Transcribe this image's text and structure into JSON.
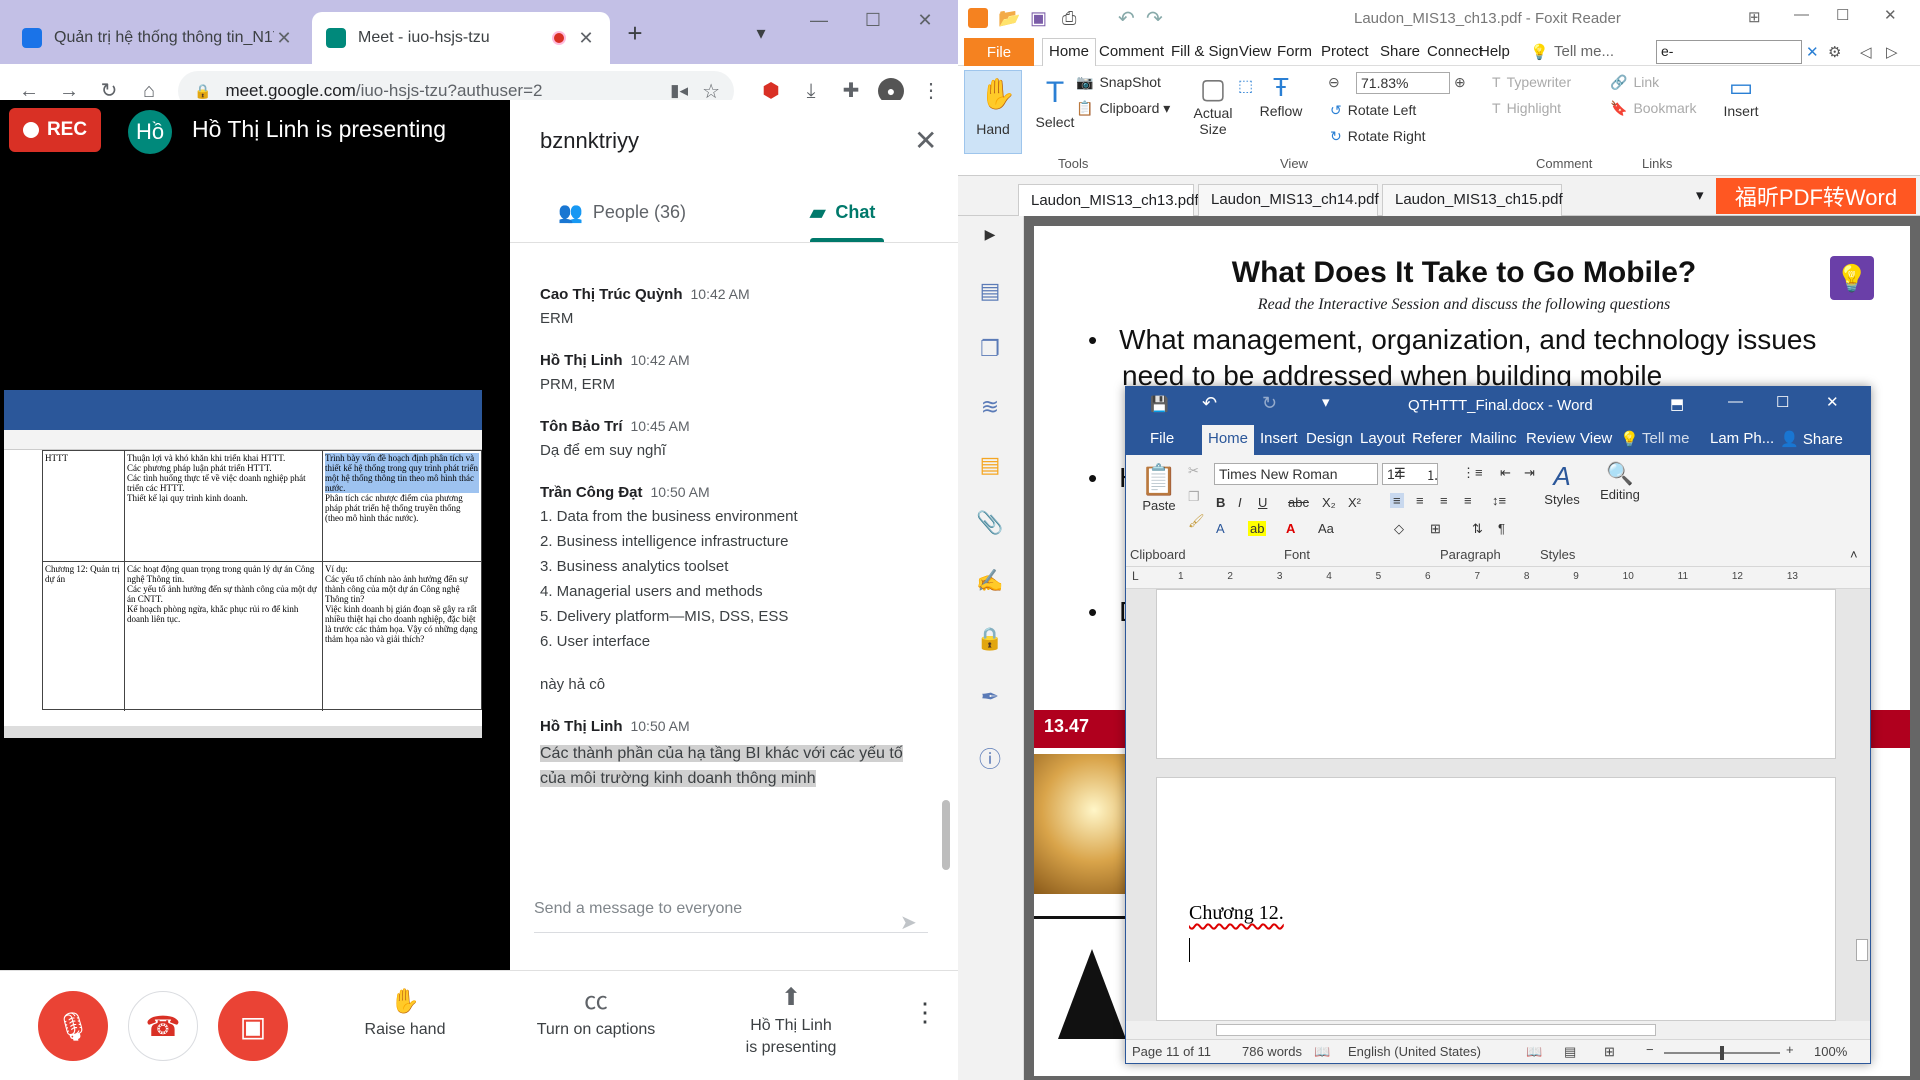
{
  "chrome": {
    "tabs": [
      {
        "title": "Quản trị hệ thống thông tin_N1T",
        "favicon_color": "#1a73e8"
      },
      {
        "title": "Meet - iuo-hsjs-tzu",
        "favicon_color": "#00897b",
        "recording": true
      }
    ],
    "url_host": "meet.google.com",
    "url_path": "/iuo-hsjs-tzu?authuser=2",
    "new_tab_label": "+"
  },
  "meet": {
    "rec_label": "REC",
    "presenter_initials": "Hồ",
    "presenting_title": "Hồ Thị Linh is presenting",
    "meeting_code": "bznnktriyy",
    "people_tab": "People (36)",
    "chat_tab": "Chat",
    "messages": [
      {
        "author": "Cao Thị Trúc Quỳnh",
        "time": "10:42 AM",
        "lines": [
          "ERM"
        ]
      },
      {
        "author": "Hồ Thị Linh",
        "time": "10:42 AM",
        "lines": [
          "PRM, ERM"
        ]
      },
      {
        "author": "Tôn Bảo Trí",
        "time": "10:45 AM",
        "lines": [
          "Dạ để em suy nghĩ"
        ]
      },
      {
        "author": "Trần Công Đạt",
        "time": "10:50 AM",
        "lines": [
          "1. Data from the business environment",
          "2. Business intelligence infrastructure",
          "3. Business analytics toolset",
          "4. Managerial users and methods",
          "5. Delivery platform—MIS, DSS, ESS",
          "6. User interface",
          "",
          "này hả cô"
        ]
      },
      {
        "author": "Hồ Thị Linh",
        "time": "10:50 AM",
        "lines": [
          "Các thành phần của hạ tầng BI khác với các yếu tố của môi trường kinh doanh thông minh"
        ],
        "selected": true
      }
    ],
    "send_placeholder": "Send a message to everyone",
    "controls": {
      "raise_hand": "Raise hand",
      "captions": "Turn on captions",
      "presenting_line1": "Hồ Thị Linh",
      "presenting_line2": "is presenting"
    },
    "shared_doc": {
      "row1_col1": "HTTT",
      "row1_col2": [
        "Thuận lợi và khó khăn khi triển khai HTTT.",
        "Các phương pháp luận phát triển HTTT.",
        "Các tình huống thực tế về việc doanh nghiệp phát triển các HTTT.",
        "Thiết kế lại quy trình kinh doanh."
      ],
      "row1_col3": [
        "Trình bày vấn đề hoạch định phân tích và thiết kế hệ thống trong quy trình phát triển một hệ thống thông tin theo mô hình thác nước.",
        "Phân tích các nhược điểm của phương pháp phát triển hệ thống truyền thống (theo mô hình thác nước)."
      ],
      "row2_col1": "Chương 12: Quản trị dự án",
      "row2_col2": [
        "Các hoạt động quan trọng trong quản lý dự án Công nghệ Thông tin.",
        "Các yếu tố ảnh hưởng đến sự thành công của một dự án CNTT.",
        "Kế hoạch phòng ngừa, khắc phục rủi ro để kinh doanh liên tục."
      ],
      "row2_col3": [
        "Ví dụ:",
        "Các yếu tố chính nào ảnh hưởng đến sự thành công của một dự án Công nghệ Thông tin?",
        "Việc kinh doanh bị gián đoạn sẽ gây ra rất nhiều thiệt hại cho doanh nghiệp, đặc biệt là trước các thảm họa. Vậy có những dạng thảm họa nào và giải thích?"
      ]
    }
  },
  "foxit": {
    "title": "Laudon_MIS13_ch13.pdf - Foxit Reader",
    "menu": [
      "Home",
      "Comment",
      "Fill & Sign",
      "View",
      "Form",
      "Protect",
      "Share",
      "Connect",
      "Help"
    ],
    "file_label": "File",
    "tell_me": "Tell me...",
    "search_value": "e-",
    "ribbon": {
      "hand": "Hand",
      "select": "Select",
      "snapshot": "SnapShot",
      "clipboard": "Clipboard",
      "actual_size": "Actual Size",
      "reflow": "Reflow",
      "zoom": "71.83%",
      "rotate_left": "Rotate Left",
      "rotate_right": "Rotate Right",
      "typewriter": "Typewriter",
      "highlight": "Highlight",
      "link": "Link",
      "bookmark": "Bookmark",
      "insert": "Insert",
      "group_tools": "Tools",
      "group_view": "View",
      "group_comment": "Comment",
      "group_links": "Links"
    },
    "doc_tabs": [
      "Laudon_MIS13_ch13.pdf",
      "Laudon_MIS13_ch14.pdf",
      "Laudon_MIS13_ch15.pdf"
    ],
    "promo": "福昕PDF转Word",
    "page": {
      "title": "What Does It Take to Go Mobile?",
      "subtitle": "Read the Interactive Session and discuss the following questions",
      "bullet1_line1": "What management, organization, and technology issues",
      "bullet1_line2": "need to be addressed when building mobile",
      "bullet2_start": "H",
      "bullet3_start": "D",
      "slide_number": "13.47"
    }
  },
  "word": {
    "title": "QTHTTT_Final.docx - Word",
    "tabs": [
      "File",
      "Home",
      "Insert",
      "Design",
      "Layout",
      "Referer",
      "Mailinc",
      "Review",
      "View"
    ],
    "tell_me": "Tell me",
    "user": "Lam Ph...",
    "share": "Share",
    "font_name": "Times New Roman",
    "font_size": "14",
    "paste": "Paste",
    "styles": "Styles",
    "editing": "Editing",
    "groups": {
      "clipboard": "Clipboard",
      "font": "Font",
      "paragraph": "Paragraph",
      "styles": "Styles"
    },
    "ruler_marks": [
      "1",
      "2",
      "3",
      "4",
      "5",
      "6",
      "7",
      "8",
      "9",
      "10",
      "11",
      "12",
      "13"
    ],
    "body_text": "Chương 12.",
    "status": {
      "page": "Page 11 of 11",
      "words": "786 words",
      "language": "English (United States)",
      "zoom": "100%"
    }
  }
}
